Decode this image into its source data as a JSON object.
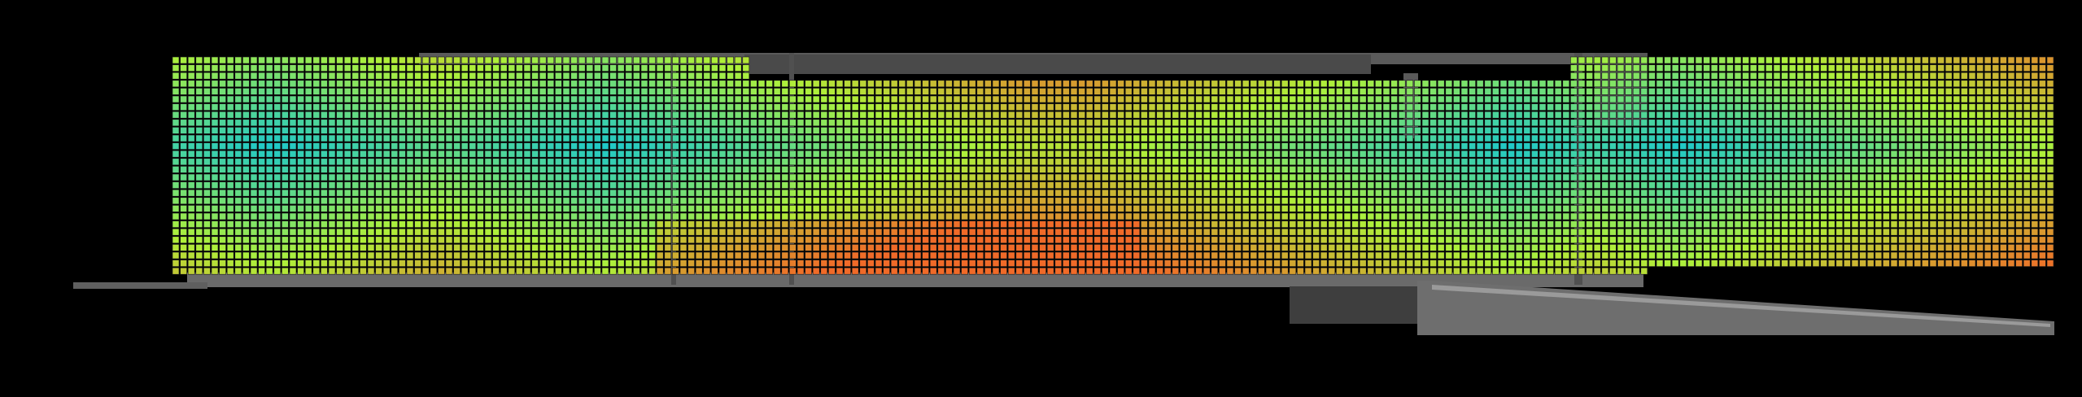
{
  "colors": {
    "background": "#000000",
    "structure": "#6e6e6e",
    "structure_dark": "#3a3a3a",
    "structure_light": "#9a9a9a",
    "grid_line": "#1a1a1a",
    "heat_low": "#1ec8c8",
    "heat_mid": "#aef03a",
    "heat_high": "#f06a28"
  }
}
